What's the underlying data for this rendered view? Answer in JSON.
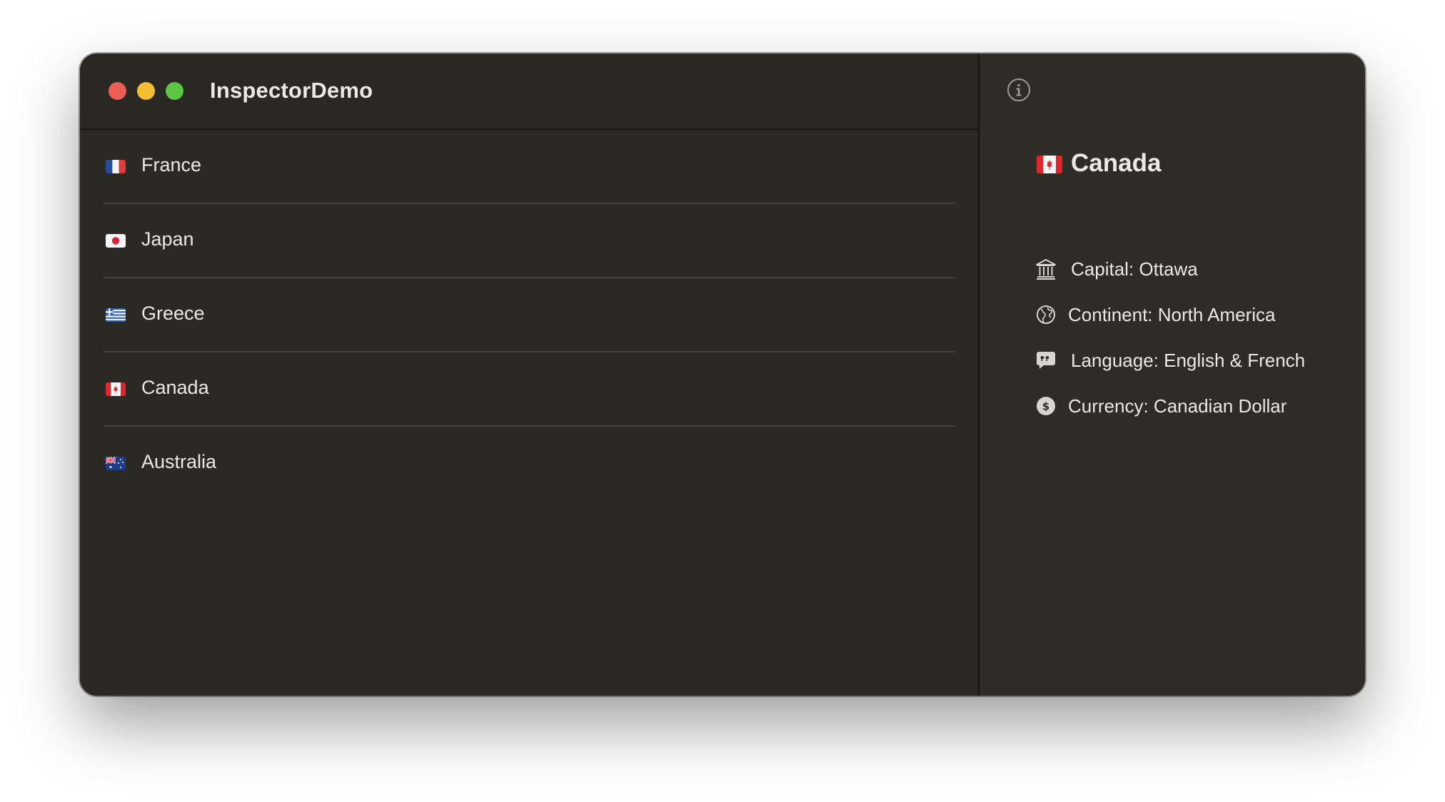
{
  "window": {
    "title": "InspectorDemo"
  },
  "countries": [
    {
      "name": "France",
      "flag": "flag-france-icon"
    },
    {
      "name": "Japan",
      "flag": "flag-japan-icon"
    },
    {
      "name": "Greece",
      "flag": "flag-greece-icon"
    },
    {
      "name": "Canada",
      "flag": "flag-canada-icon"
    },
    {
      "name": "Australia",
      "flag": "flag-australia-icon"
    }
  ],
  "inspector": {
    "info_icon": "info-circle-icon",
    "title": "Canada",
    "flag": "flag-canada-icon",
    "details": {
      "capital": "Capital: Ottawa",
      "continent": "Continent: North America",
      "language": "Language: English & French",
      "currency": "Currency: Canadian Dollar"
    }
  },
  "colors": {
    "close": "#ec5f57",
    "minimize": "#f5bd31",
    "maximize": "#5ec444",
    "background": "#2b2923",
    "text": "#ece9e2"
  }
}
